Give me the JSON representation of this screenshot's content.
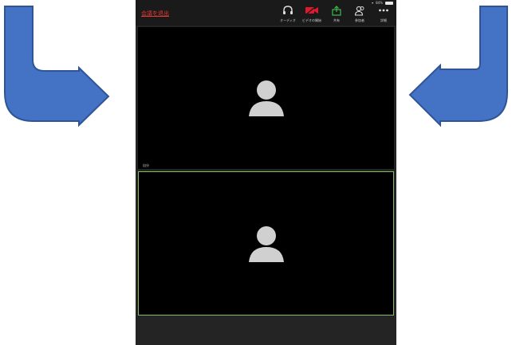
{
  "status_bar": {
    "battery": "84%"
  },
  "toolbar": {
    "leave_label": "会議を退出",
    "items": [
      {
        "label": "オーディオ",
        "icon": "headphones-icon"
      },
      {
        "label": "ビデオの開始",
        "icon": "video-off-icon"
      },
      {
        "label": "共有",
        "icon": "share-icon"
      },
      {
        "label": "参加者",
        "icon": "participants-icon"
      },
      {
        "label": "詳細",
        "icon": "more-icon"
      }
    ]
  },
  "video": {
    "name_tag": "自分"
  },
  "colors": {
    "arrow": "#4472c4",
    "leave": "#e53935",
    "active_border": "#7fbf5f",
    "video_off": "#e0192e",
    "share": "#3fb950"
  }
}
